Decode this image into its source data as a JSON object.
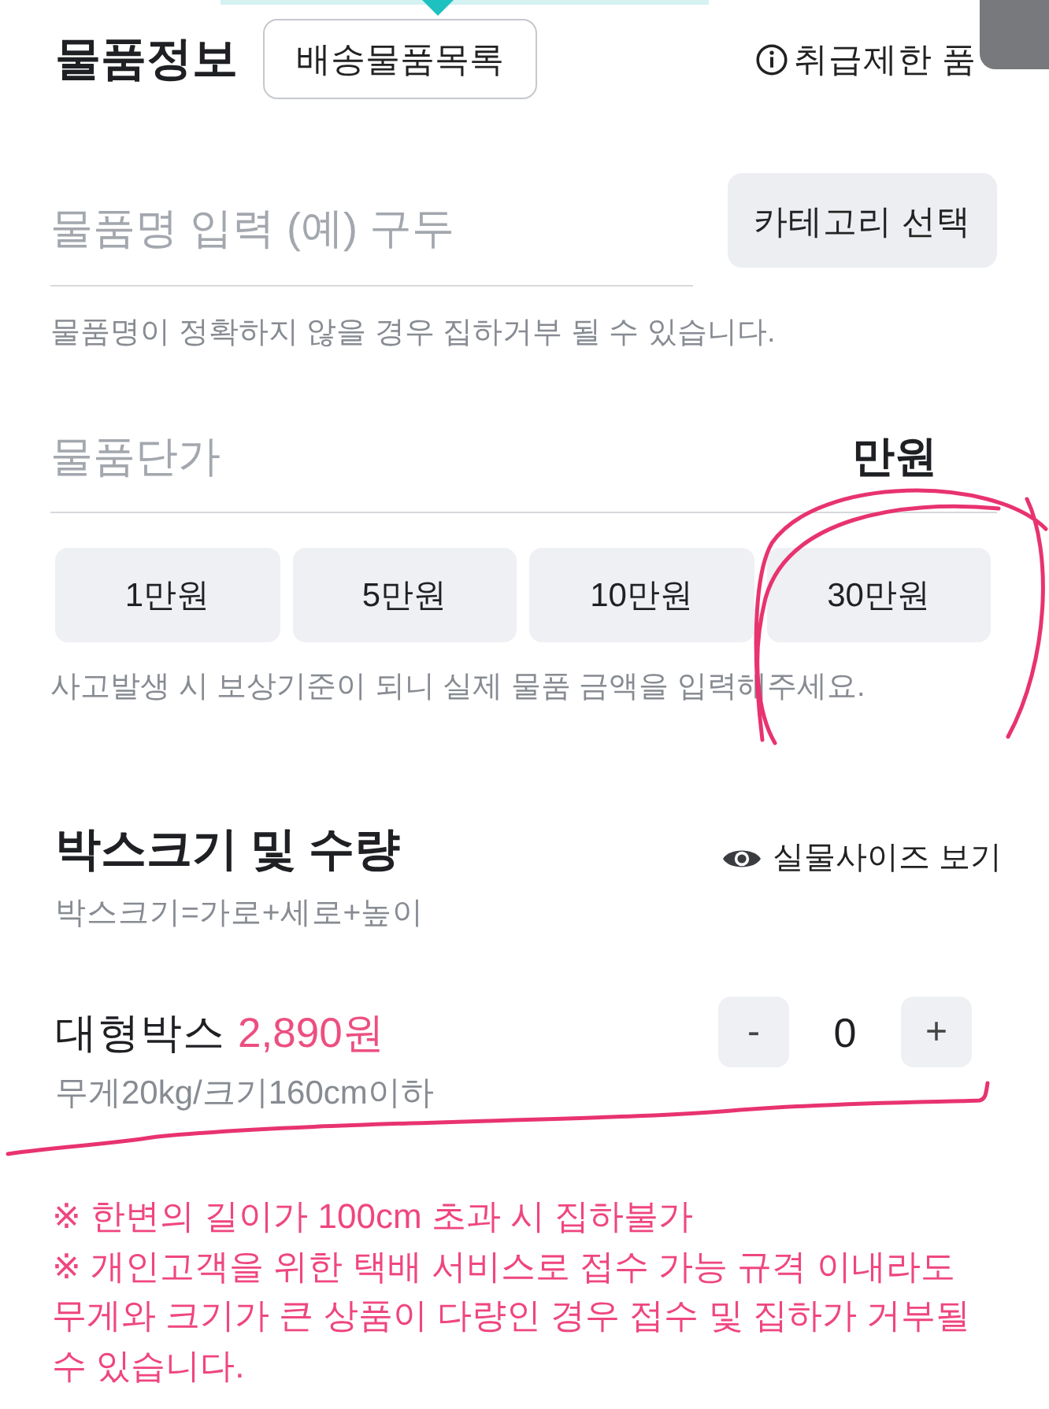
{
  "header": {
    "title": "물품정보",
    "list_button": "배송물품목록",
    "restricted_link": "취급제한 품"
  },
  "item_name": {
    "placeholder": "물품명 입력 (예) 구두",
    "category_button": "카테고리 선택",
    "hint": "물품명이 정확하지 않을 경우 집하거부 될 수 있습니다."
  },
  "price": {
    "placeholder": "물품단가",
    "unit": "만원",
    "presets": [
      {
        "label": "1만원",
        "selected": false
      },
      {
        "label": "5만원",
        "selected": false
      },
      {
        "label": "10만원",
        "selected": false
      },
      {
        "label": "30만원",
        "selected": false
      }
    ],
    "hint": "사고발생 시 보상기준이 되니 실제 물품 금액을 입력해주세요."
  },
  "box": {
    "title": "박스크기 및 수량",
    "size_link": "실물사이즈 보기",
    "formula": "박스크기=가로+세로+높이",
    "items": [
      {
        "name": "대형박스",
        "price": "2,890원",
        "limits": "무게20kg/크기160cm이하",
        "decrement": "-",
        "quantity": "0",
        "increment": "+"
      }
    ]
  },
  "notes": [
    "※ 한변의 길이가 100cm 초과 시 집하불가",
    "※ 개인고객을 위한 택배 서비스로 접수 가능 규격 이내라도 무게와 크기가 큰 상품이 다량인 경우 접수 및 집하가 거부될 수 있습니다."
  ]
}
